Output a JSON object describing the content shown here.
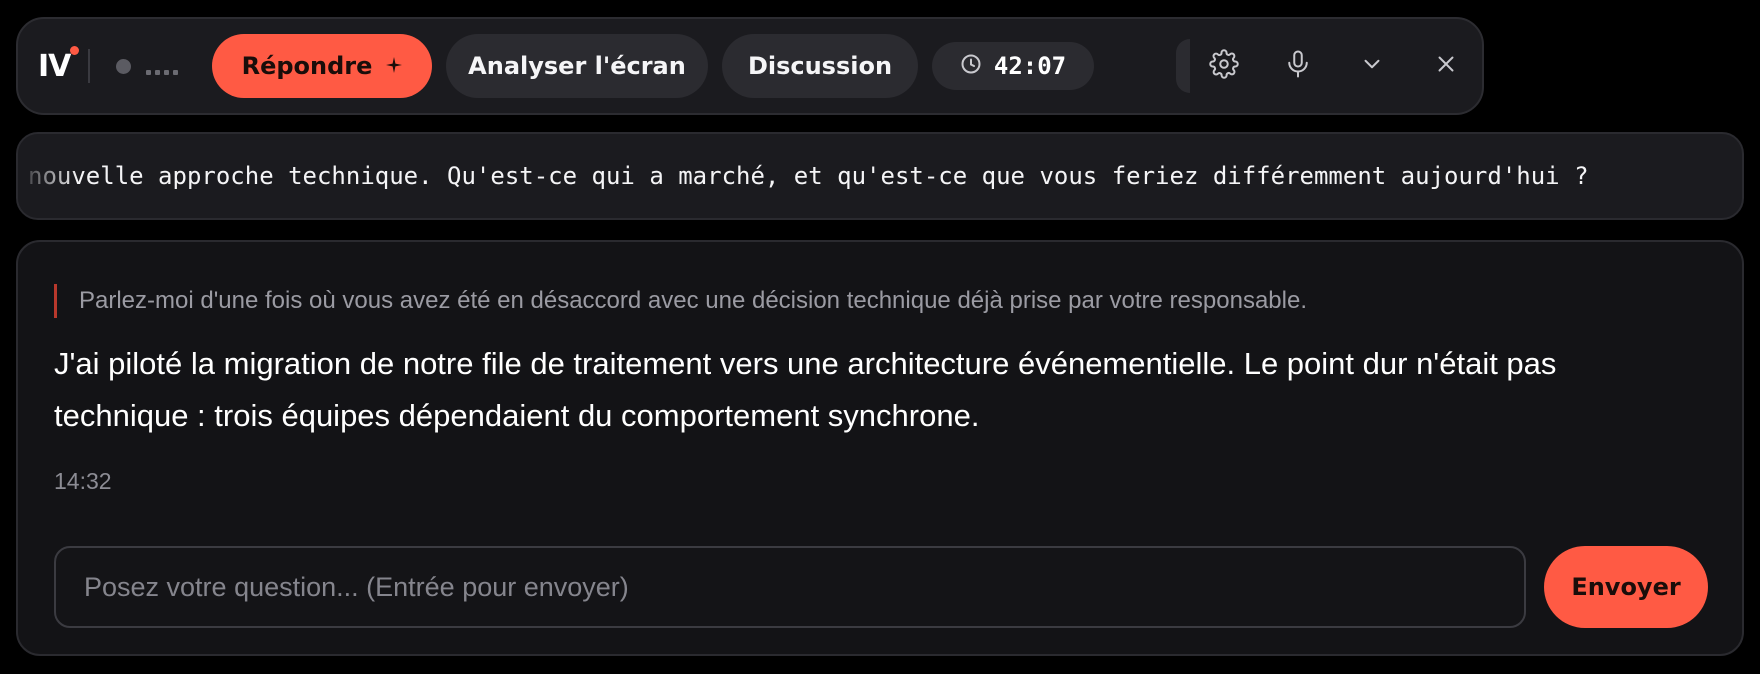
{
  "toolbar": {
    "logo_text": "IV",
    "status_indicator": "....",
    "respond_label": "Répondre",
    "respond_icon": "sparkle-icon",
    "analyze_label": "Analyser l'écran",
    "discussion_label": "Discussion",
    "timer": "42:07",
    "timer_icon": "clock-icon",
    "settings_icon": "gear-icon",
    "mic_icon": "microphone-icon",
    "collapse_icon": "chevron-down-icon",
    "close_icon": "close-icon"
  },
  "transcript": {
    "text": "nouvelle approche technique. Qu'est-ce qui a marché, et qu'est-ce que vous feriez différemment aujourd'hui ?"
  },
  "conversation": {
    "question": "Parlez-moi d'une fois où vous avez été en désaccord avec une décision technique déjà prise par votre responsable.",
    "answer": "J'ai piloté la migration de notre file de traitement vers une architecture événementielle. Le point dur n'était pas technique : trois équipes dépendaient du comportement synchrone.",
    "timestamp": "14:32"
  },
  "composer": {
    "placeholder": "Posez votre question... (Entrée pour envoyer)",
    "value": "",
    "send_label": "Envoyer"
  },
  "colors": {
    "accent": "#ff5a44",
    "background": "#000000",
    "panel": "#1b1b1f",
    "card": "#131316",
    "quote_bar": "#b8382c"
  }
}
